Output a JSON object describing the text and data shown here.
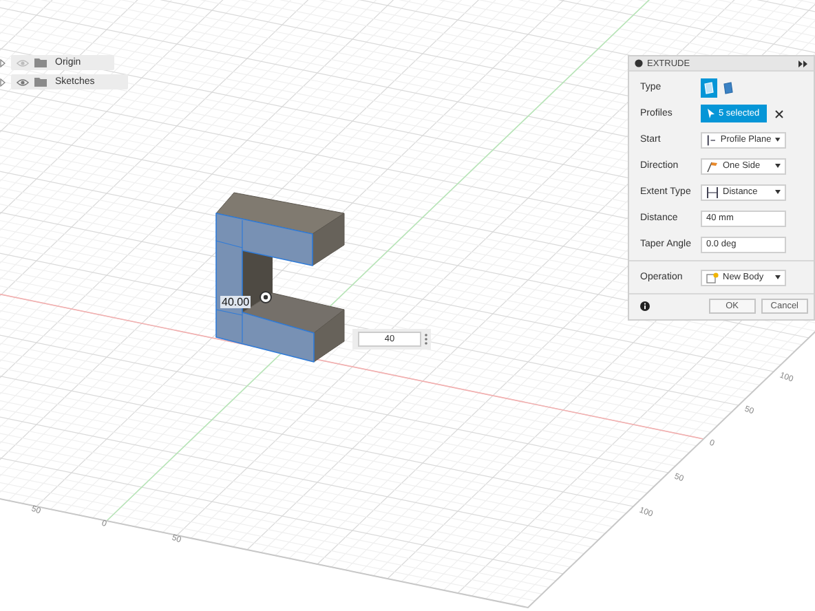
{
  "browser": {
    "items": [
      {
        "label": "Origin",
        "visible": false
      },
      {
        "label": "Sketches",
        "visible": true
      }
    ]
  },
  "viewport": {
    "dimension_label": "40.00",
    "distance_input": "40",
    "right_axis_labels": [
      "100",
      "50",
      "0",
      "50",
      "100"
    ],
    "bottom_axis_labels": [
      "50",
      "0",
      "50"
    ]
  },
  "dialog": {
    "title": "EXTRUDE",
    "sections": [
      [
        {
          "kind": "type",
          "label": "Type",
          "options": [
            {
              "selected": true
            },
            {
              "selected": false
            }
          ]
        },
        {
          "kind": "selection",
          "label": "Profiles",
          "value": "5 selected"
        },
        {
          "kind": "dropdown",
          "label": "Start",
          "value": "Profile Plane"
        },
        {
          "kind": "dropdown",
          "label": "Direction",
          "value": "One Side"
        },
        {
          "kind": "dropdown",
          "label": "Extent Type",
          "value": "Distance"
        },
        {
          "kind": "field",
          "label": "Distance",
          "value": "40 mm"
        },
        {
          "kind": "field",
          "label": "Taper Angle",
          "value": "0.0 deg"
        }
      ],
      [
        {
          "kind": "dropdown",
          "label": "Operation",
          "value": "New Body"
        }
      ]
    ],
    "buttons": [
      "OK",
      "Cancel"
    ]
  }
}
